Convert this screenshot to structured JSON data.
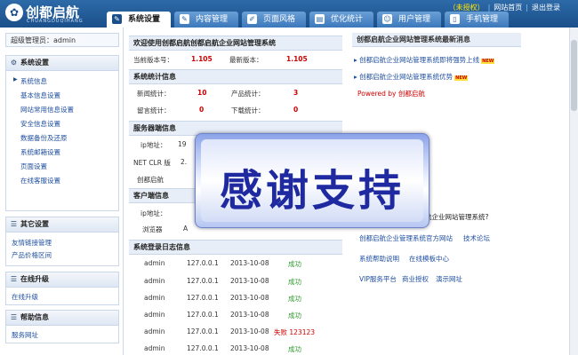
{
  "brand": {
    "name": "创都启航",
    "sub": "CHUANGDUQIHANG"
  },
  "toplinks": {
    "unauth": "（未授权）",
    "site_home": "网站首页",
    "logout": "退出登录"
  },
  "tabs": [
    {
      "label": "系统设置",
      "icon": "wrench-icon",
      "glyph": "✎"
    },
    {
      "label": "内容管理",
      "icon": "edit-icon",
      "glyph": "✎"
    },
    {
      "label": "页面风格",
      "icon": "brush-icon",
      "glyph": "✐"
    },
    {
      "label": "优化统计",
      "icon": "chart-icon",
      "glyph": "▤"
    },
    {
      "label": "用户管理",
      "icon": "user-icon",
      "glyph": "☺"
    },
    {
      "label": "手机管理",
      "icon": "phone-icon",
      "glyph": "▯"
    }
  ],
  "admin": "超级管理员：admin",
  "sidebar": {
    "system": {
      "title": "系统设置",
      "items": [
        "系统信息",
        "基本信息设置",
        "网站常用信息设置",
        "安全信息设置",
        "数据备份及还原",
        "系统邮箱设置",
        "页面设置",
        "在线客服设置"
      ]
    },
    "other": {
      "title": "其它设置",
      "items": [
        "友情链接管理",
        "产品价格区间"
      ]
    },
    "upgrade": {
      "title": "在线升级",
      "items": [
        "在线升级"
      ]
    },
    "help": {
      "title": "帮助信息",
      "items": [
        "服务网址"
      ]
    }
  },
  "welcome": {
    "title": "欢迎使用创都启航创都启航企业网站管理系统",
    "current_label": "当前版本号：",
    "current": "1.105",
    "latest_label": "最新版本：",
    "latest": "1.105"
  },
  "stats": {
    "title": "系统统计信息",
    "news_label": "新闻统计：",
    "news": "10",
    "product_label": "产品统计：",
    "product": "3",
    "message_label": "留言统计：",
    "message": "0",
    "download_label": "下载统计：",
    "download": "0"
  },
  "server": {
    "title": "服务器端信息",
    "ip_label": "ip地址：",
    "ip_partial": "19",
    "netclr_label": "NET CLR 版",
    "netclr_partial": "2.",
    "auth_label": "创都启航"
  },
  "client": {
    "title": "客户端信息",
    "ip_label": "ip地址：",
    "browser_label": "浏览器",
    "browser_partial": "A"
  },
  "log": {
    "title": "系统登录日志信息",
    "rows": [
      {
        "user": "admin",
        "ip": "127.0.0.1",
        "date": "2013-10-08",
        "status": "成功"
      },
      {
        "user": "admin",
        "ip": "127.0.0.1",
        "date": "2013-10-08",
        "status": "成功"
      },
      {
        "user": "admin",
        "ip": "127.0.0.1",
        "date": "2013-10-08",
        "status": "成功"
      },
      {
        "user": "admin",
        "ip": "127.0.0.1",
        "date": "2013-10-08",
        "status": "成功"
      },
      {
        "user": "admin",
        "ip": "127.0.0.1",
        "date": "2013-10-08",
        "status": "失败 123123"
      },
      {
        "user": "admin",
        "ip": "127.0.0.1",
        "date": "2013-10-08",
        "status": "成功"
      }
    ]
  },
  "news": {
    "title": "创都启航企业网站管理系统最新消息",
    "items": [
      {
        "text": "创都启航企业网站管理系统即将强势上线",
        "badge": "NEW"
      },
      {
        "text": "创都启航企业网站管理系统优势",
        "badge": "NEW"
      }
    ],
    "powered": "Powered by 创都启航"
  },
  "links": {
    "question": "航企业网站管理系统?",
    "rows": [
      [
        "创都启航企业管理系统官方网站",
        "技术论坛"
      ],
      [
        "系统帮助说明",
        "在线模板中心"
      ],
      [
        "VIP服务平台",
        "商业授权",
        "演示网址"
      ]
    ]
  },
  "overlay": "感谢支持"
}
